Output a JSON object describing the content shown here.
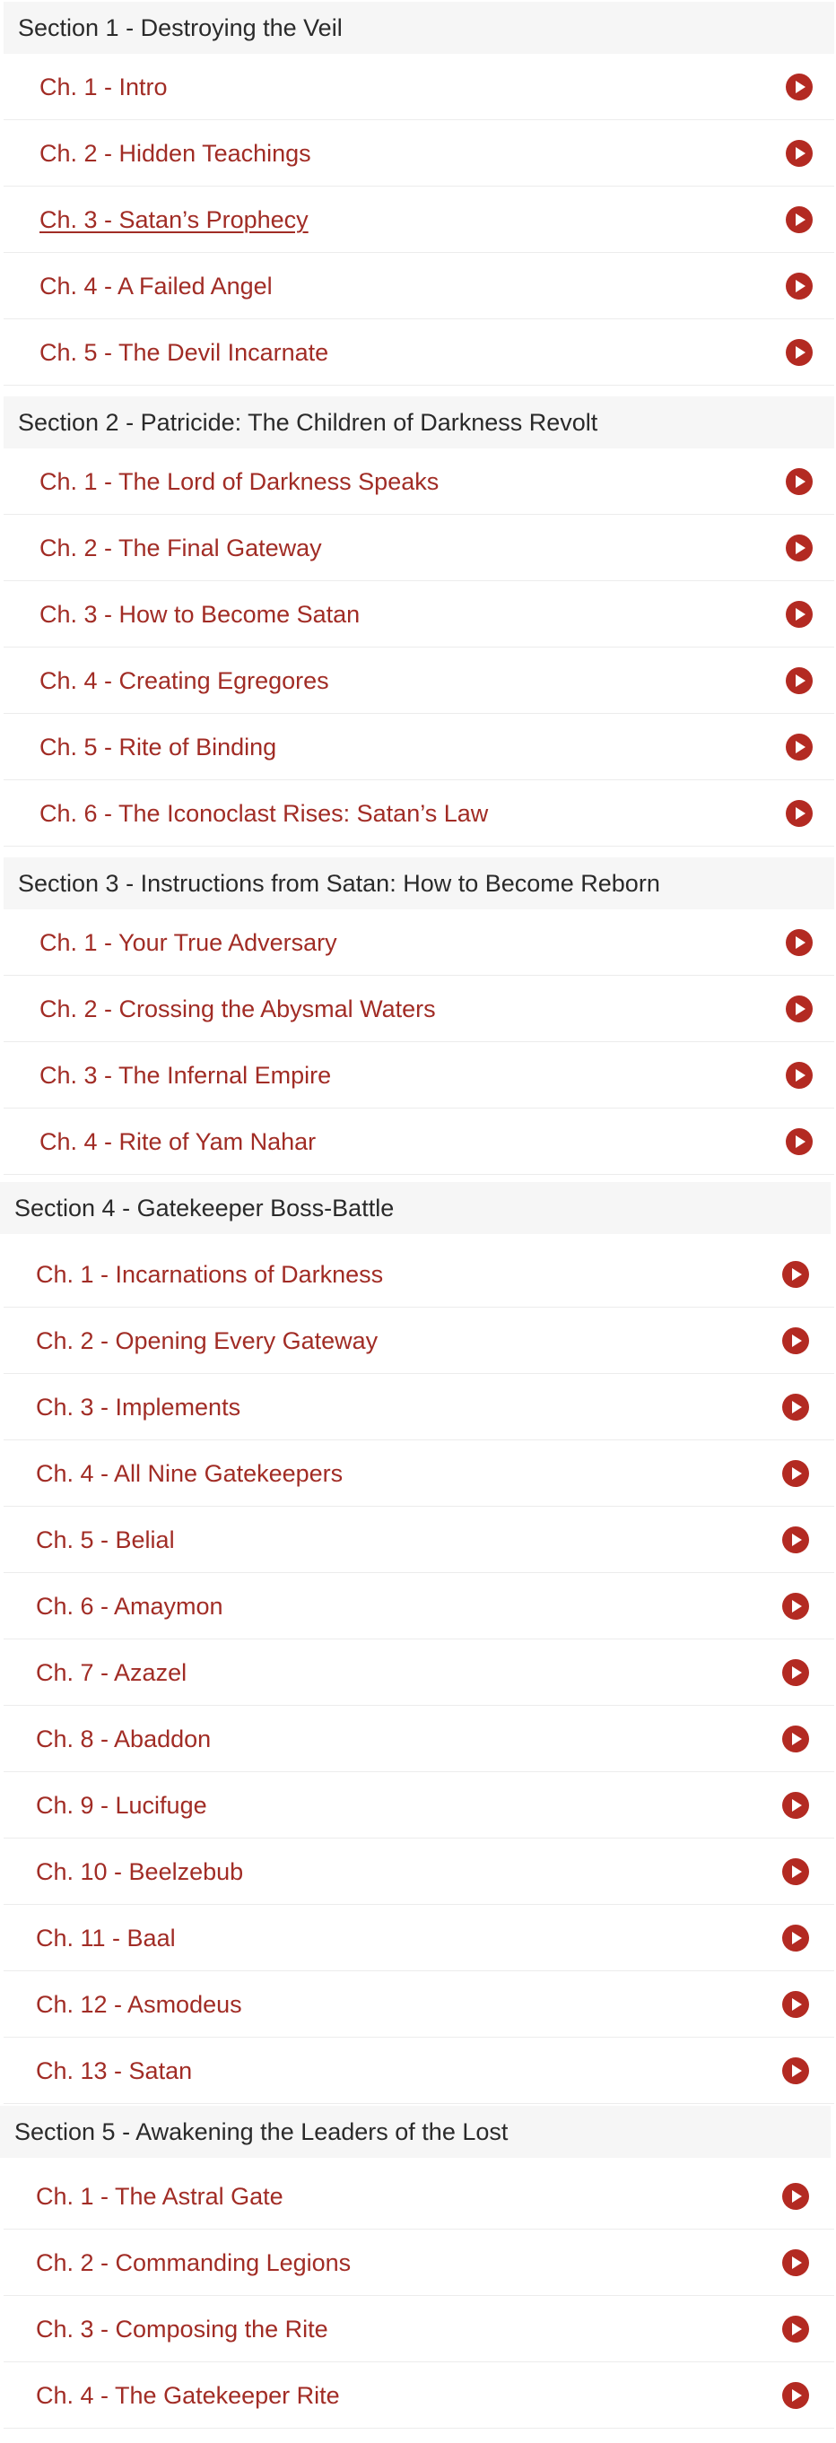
{
  "accent_color": "#a12c25",
  "play_icon_color": "#b32a22",
  "icon": "play-circle-icon",
  "sections": [
    {
      "title": "Section 1 - Destroying the Veil",
      "lectures": [
        {
          "label": "Ch. 1 - Intro"
        },
        {
          "label": "Ch. 2 - Hidden Teachings"
        },
        {
          "label": "Ch. 3 - Satan’s Prophecy",
          "underlined": true
        },
        {
          "label": "Ch. 4 - A Failed Angel"
        },
        {
          "label": "Ch. 5 - The Devil Incarnate"
        }
      ]
    },
    {
      "title": "Section 2 - Patricide: The Children of Darkness Revolt",
      "lectures": [
        {
          "label": "Ch. 1 - The Lord of Darkness Speaks"
        },
        {
          "label": "Ch. 2 - The Final Gateway"
        },
        {
          "label": "Ch. 3 - How to Become Satan"
        },
        {
          "label": "Ch. 4 - Creating Egregores"
        },
        {
          "label": "Ch. 5 - Rite of Binding"
        },
        {
          "label": "Ch. 6 - The Iconoclast Rises: Satan’s Law"
        }
      ]
    },
    {
      "title": "Section 3 - Instructions from Satan: How to Become Reborn",
      "lectures": [
        {
          "label": "Ch. 1 - Your True Adversary"
        },
        {
          "label": "Ch. 2 - Crossing the Abysmal Waters"
        },
        {
          "label": "Ch. 3 - The Infernal Empire"
        },
        {
          "label": "Ch. 4 - Rite of Yam Nahar"
        }
      ]
    },
    {
      "title": "Section 4 - Gatekeeper Boss-Battle",
      "lectures": [
        {
          "label": "Ch. 1 - Incarnations of Darkness"
        },
        {
          "label": "Ch. 2 - Opening Every Gateway"
        },
        {
          "label": "Ch. 3 - Implements"
        },
        {
          "label": "Ch. 4 - All Nine Gatekeepers"
        },
        {
          "label": "Ch. 5 - Belial"
        },
        {
          "label": "Ch. 6 - Amaymon"
        },
        {
          "label": "Ch. 7 - Azazel"
        },
        {
          "label": "Ch. 8 - Abaddon"
        },
        {
          "label": "Ch. 9 - Lucifuge"
        },
        {
          "label": "Ch. 10 - Beelzebub"
        },
        {
          "label": "Ch. 11 - Baal"
        },
        {
          "label": "Ch. 12 - Asmodeus"
        },
        {
          "label": "Ch. 13 - Satan"
        }
      ]
    },
    {
      "title": "Section 5 - Awakening the Leaders of the Lost",
      "lectures": [
        {
          "label": "Ch. 1 - The Astral Gate"
        },
        {
          "label": "Ch. 2 - Commanding Legions"
        },
        {
          "label": "Ch. 3 - Composing the Rite"
        },
        {
          "label": "Ch. 4 - The Gatekeeper Rite"
        }
      ]
    }
  ]
}
